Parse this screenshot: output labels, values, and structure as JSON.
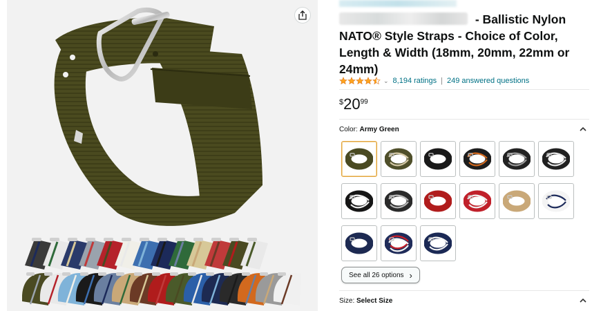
{
  "product": {
    "brand_prefix": "…ch Banded…",
    "title_rest": " - Ballistic Nylon NATO® Style Straps - Choice of Color, Length & Width (18mm, 20mm, 22mm or 24mm)",
    "rating_value": 4.5,
    "ratings_count": "8,194 ratings",
    "separator": "|",
    "answered_questions": "249 answered questions",
    "price": {
      "symbol": "$",
      "whole": "20",
      "fraction": "99"
    }
  },
  "color_selector": {
    "label": "Color:",
    "selected": "Army Green",
    "options": [
      {
        "name": "Army Green",
        "colors": [
          "#4a4a22"
        ]
      },
      {
        "name": "Army Green Beige",
        "colors": [
          "#4f4f2a",
          "#d4c8a5"
        ]
      },
      {
        "name": "Black",
        "colors": [
          "#1a1a1a"
        ]
      },
      {
        "name": "Black Orange",
        "colors": [
          "#1d1d1d",
          "#d2691e"
        ]
      },
      {
        "name": "Black Gray",
        "colors": [
          "#222222",
          "#9a9a9a"
        ]
      },
      {
        "name": "Black White",
        "colors": [
          "#202020",
          "#e8e8e8"
        ]
      },
      {
        "name": "Black White Stripe",
        "colors": [
          "#151515",
          "#f0f0f0"
        ]
      },
      {
        "name": "Black Gray Stripe",
        "colors": [
          "#2a2a2a",
          "#b8b8b8"
        ]
      },
      {
        "name": "Red",
        "colors": [
          "#b01c1c"
        ]
      },
      {
        "name": "Red White",
        "colors": [
          "#c0202a",
          "#f2f2f2"
        ]
      },
      {
        "name": "Sand",
        "colors": [
          "#c9a878"
        ]
      },
      {
        "name": "White Navy",
        "colors": [
          "#f4f4f4",
          "#1c2a5a"
        ]
      },
      {
        "name": "Navy",
        "colors": [
          "#1d2a52"
        ]
      },
      {
        "name": "Navy Red White",
        "colors": [
          "#1f2c5a",
          "#c8202a",
          "#f5f5f5"
        ]
      },
      {
        "name": "Navy White",
        "colors": [
          "#1b2955",
          "#f5f5f5"
        ]
      }
    ],
    "see_all_label": "See all 26 options",
    "chevron": "^"
  },
  "size_selector": {
    "label": "Size:",
    "value": "Select Size"
  },
  "collage_colors": [
    "#3a3a3a",
    "#e8e8e8",
    "#2a3a6a",
    "#9aa3ad",
    "#b5222a",
    "#f0efe8",
    "#3d6fb0",
    "#1c2a5a",
    "#2f6a3a",
    "#d7c898",
    "#c03a3a",
    "#4a4a22",
    "#e9e9e9",
    "#7fb3d9",
    "#1a1a1a",
    "#6a7fa0",
    "#c9a878",
    "#6b3a26",
    "#b01c1c",
    "#4a5a2a",
    "#2b5fa8",
    "#1d2a52",
    "#2a2a2a",
    "#d2691e",
    "#9a9a9a",
    "#f0f0f0"
  ],
  "icons": {
    "share": "share-icon",
    "expand": "chevron-up-icon",
    "arrow": "chevron-right-icon",
    "star": "star-icon"
  }
}
